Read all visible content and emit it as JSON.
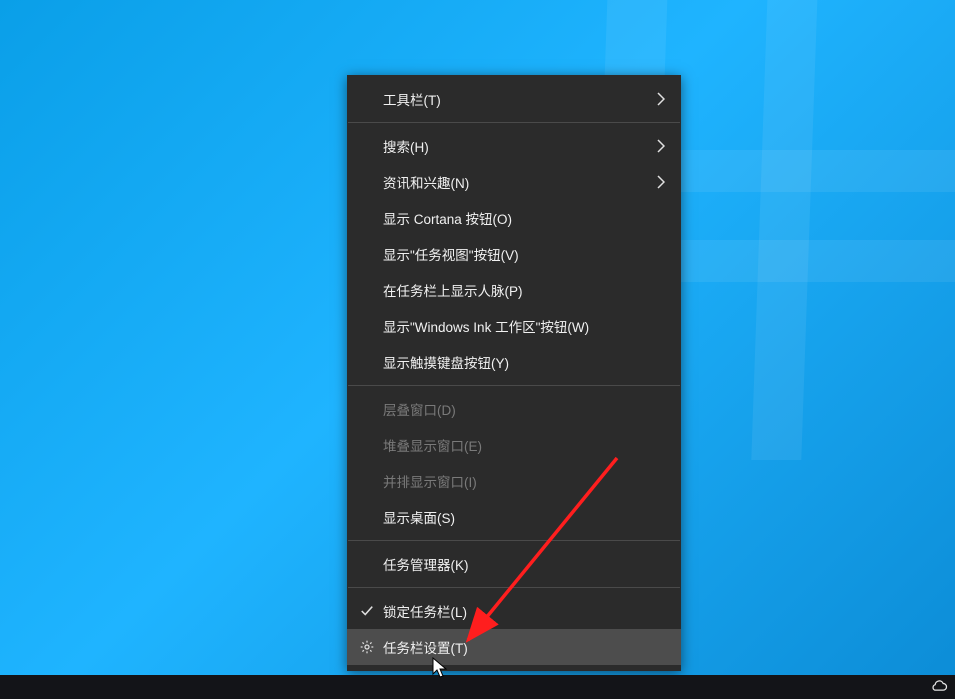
{
  "contextMenu": {
    "toolbars": {
      "label": "工具栏(T)",
      "hasSubmenu": true
    },
    "search": {
      "label": "搜索(H)",
      "hasSubmenu": true
    },
    "newsInterests": {
      "label": "资讯和兴趣(N)",
      "hasSubmenu": true
    },
    "showCortana": {
      "label": "显示 Cortana 按钮(O)"
    },
    "showTaskView": {
      "label": "显示\"任务视图\"按钮(V)"
    },
    "showPeople": {
      "label": "在任务栏上显示人脉(P)"
    },
    "showWindowsInk": {
      "label": "显示\"Windows Ink 工作区\"按钮(W)"
    },
    "showTouchKb": {
      "label": "显示触摸键盘按钮(Y)"
    },
    "cascadeWindows": {
      "label": "层叠窗口(D)",
      "disabled": true
    },
    "stackWindows": {
      "label": "堆叠显示窗口(E)",
      "disabled": true
    },
    "sideBySide": {
      "label": "并排显示窗口(I)",
      "disabled": true
    },
    "showDesktop": {
      "label": "显示桌面(S)"
    },
    "taskManager": {
      "label": "任务管理器(K)"
    },
    "lockTaskbar": {
      "label": "锁定任务栏(L)",
      "checked": true
    },
    "taskbarSettings": {
      "label": "任务栏设置(T)",
      "icon": "gear",
      "highlight": true
    }
  }
}
